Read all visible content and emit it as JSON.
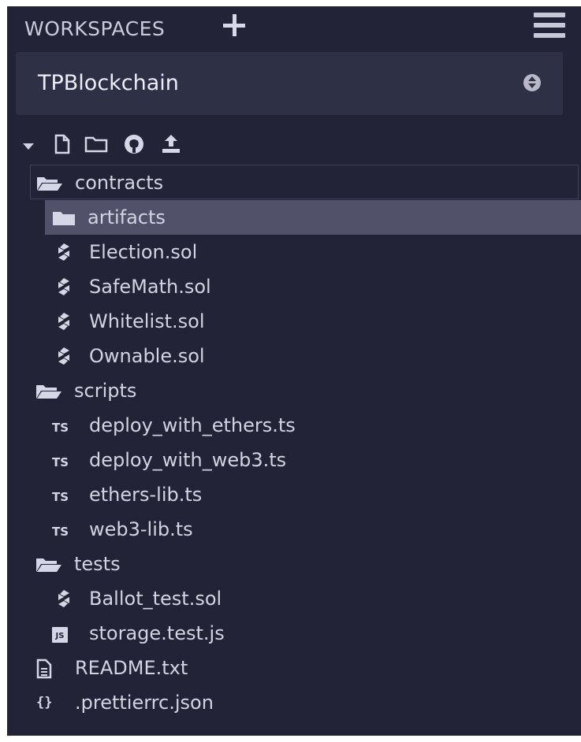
{
  "header": {
    "title": "WORKSPACES"
  },
  "workspace_select": {
    "value": "TPBlockchain"
  },
  "toolbar": {
    "icons": [
      "caret-down-icon",
      "new-file-icon",
      "new-folder-icon",
      "github-icon",
      "upload-icon"
    ]
  },
  "tree": {
    "contracts": {
      "label": "contracts",
      "artifacts": "artifacts",
      "files": [
        "Election.sol",
        "SafeMath.sol",
        "Whitelist.sol",
        "Ownable.sol"
      ]
    },
    "scripts": {
      "label": "scripts",
      "files": [
        "deploy_with_ethers.ts",
        "deploy_with_web3.ts",
        "ethers-lib.ts",
        "web3-lib.ts"
      ]
    },
    "tests": {
      "label": "tests",
      "files": [
        "Ballot_test.sol",
        "storage.test.js"
      ]
    },
    "root_files": [
      "README.txt",
      ".prettierrc.json"
    ],
    "ts_badge": "TS",
    "js_badge": "JS"
  },
  "colors": {
    "panel": "#222336",
    "select": "#2e3045",
    "selected_row": "#51526a",
    "text": "#d3d4e2"
  }
}
